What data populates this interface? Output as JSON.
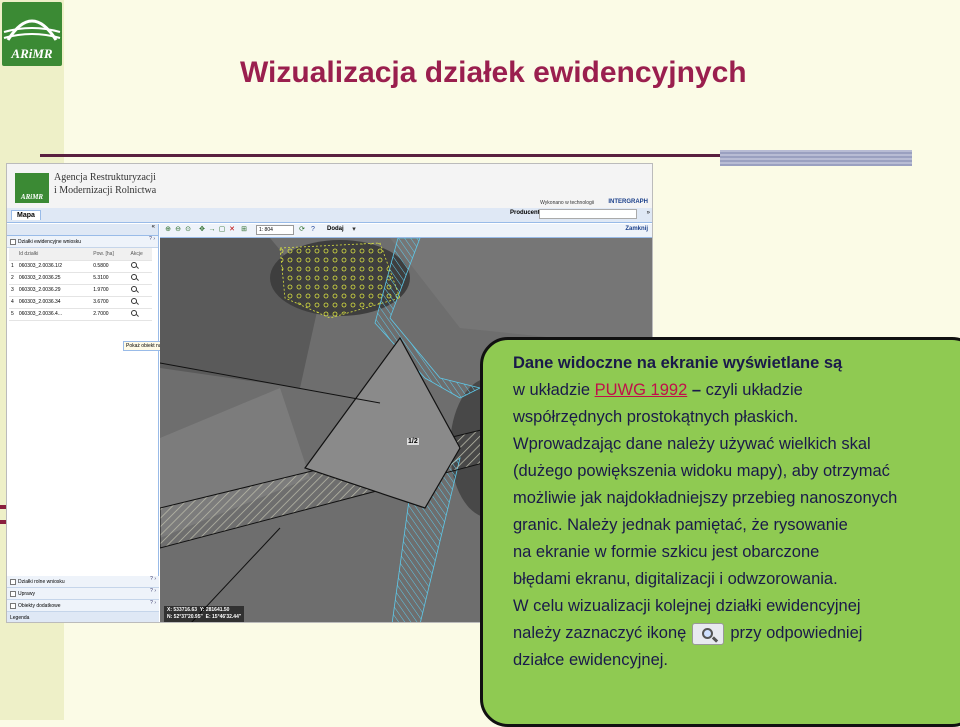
{
  "slide": {
    "logo_text": "ARiMR",
    "title": "Wizualizacja działek ewidencyjnych"
  },
  "app": {
    "logo_text": "ARiMR",
    "agency_line1": "Agencja Restrukturyzacji",
    "agency_line2": "i Modernizacji Rolnictwa",
    "tech_text": "Wykonano w technologii",
    "tech_brand": "INTERGRAPH",
    "tab_label": "Mapa",
    "producent_label": "Producent:",
    "producent_value": "",
    "collapse_icon": "«",
    "panel_title": "Działki ewidencyjne wniosku",
    "columns": [
      "",
      "Id działki",
      "Pow. [ha]",
      "Akcje"
    ],
    "parcels": [
      {
        "no": "1",
        "id": "060303_2.0036.1/2",
        "area": "0.5800"
      },
      {
        "no": "2",
        "id": "060303_2.0036.25",
        "area": "5.3100"
      },
      {
        "no": "3",
        "id": "060303_2.0036.29",
        "area": "1.9700"
      },
      {
        "no": "4",
        "id": "060303_2.0036.34",
        "area": "3.6700"
      },
      {
        "no": "5",
        "id": "060303_2.0036.4...",
        "area": "2.7000"
      }
    ],
    "tooltip": "Pokaż obiekt na mapie",
    "bottom_layers": [
      "Działki rolne wniosku",
      "Uprawy",
      "Obiekty dodatkowe"
    ],
    "legend_label": "Legenda",
    "scale_value": "1: 804",
    "dodaj_label": "Dodaj",
    "zamknij_label": "Zamknij",
    "map": {
      "parcel_label": "1/2",
      "coord_x": "X: 533716.63",
      "coord_y": "Y: 281641.50",
      "coord_n": "N: 52°37'20.95\"",
      "coord_e": "E: 15°46'32.44\""
    }
  },
  "callout": {
    "l1": "Dane widoczne na ekranie wyświetlane są",
    "l2a": "w układzie ",
    "l2_puwg": "PUWG 1992",
    "l2b": " – ",
    "l2c": "czyli układzie",
    "l3": "współrzędnych prostokątnych płaskich.",
    "l4": "Wprowadzając dane należy używać wielkich skal",
    "l5": "(dużego powiększenia widoku mapy), aby otrzymać",
    "l6": "możliwie jak najdokładniejszy przebieg nanoszonych",
    "l7": "granic. Należy jednak pamiętać, że rysowanie",
    "l8": "na ekranie w formie szkicu jest obarczone",
    "l9": "błędami ekranu, digitalizacji i odwzorowania.",
    "l10": "W celu wizualizacji kolejnej działki ewidencyjnej",
    "l11a": "należy zaznaczyć ikonę",
    "l11b": "przy odpowiedniej",
    "l12": "działce ewidencyjnej."
  }
}
